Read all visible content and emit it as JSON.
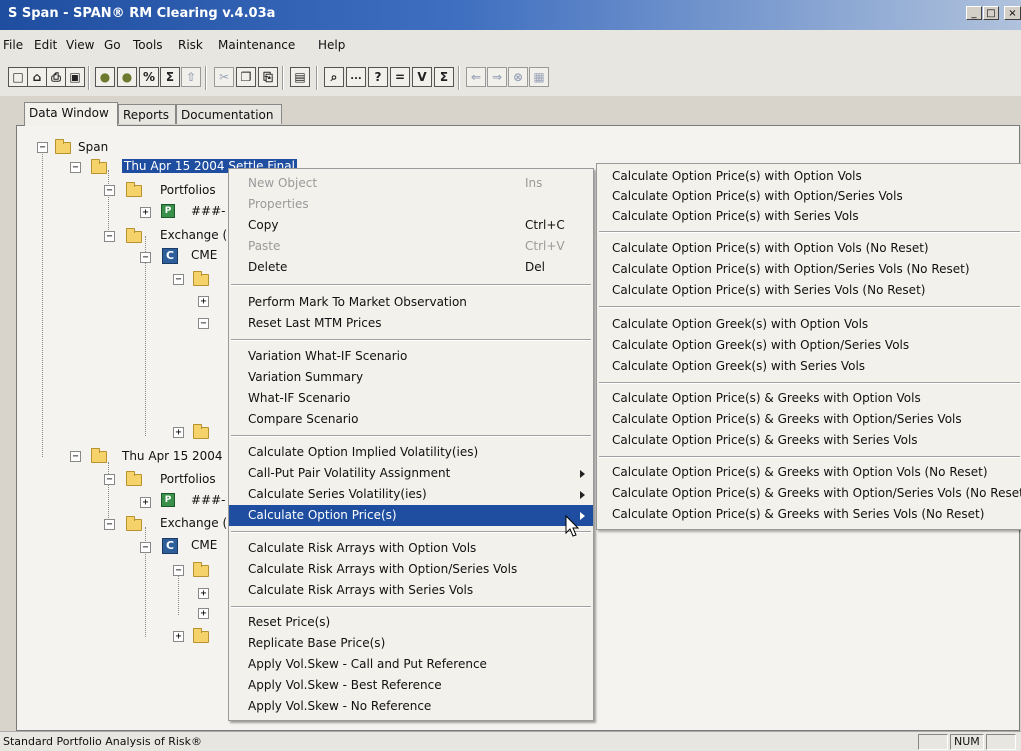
{
  "window": {
    "title": "S Span - SPAN® RM Clearing v.4.03a",
    "minimize": "_",
    "restore": "□",
    "close": "×"
  },
  "menubar": [
    "File",
    "Edit",
    "View",
    "Go",
    "Tools",
    "Risk",
    "Maintenance",
    "Help"
  ],
  "toolbar": {
    "buttons": [
      {
        "icon": "new-icon",
        "glyph": "□"
      },
      {
        "icon": "open-icon",
        "glyph": "⌂"
      },
      {
        "icon": "print-icon",
        "glyph": "⎙"
      },
      {
        "icon": "save-icon",
        "glyph": "▣"
      },
      {
        "icon": "risk-icon-1",
        "glyph": "●"
      },
      {
        "icon": "risk-icon-2",
        "glyph": "●"
      },
      {
        "icon": "percent-icon",
        "glyph": "%"
      },
      {
        "icon": "sigma-icon",
        "glyph": "Σ"
      },
      {
        "icon": "upload-icon",
        "glyph": "⇧"
      },
      {
        "icon": "cut-icon",
        "glyph": "✂"
      },
      {
        "icon": "copy-icon",
        "glyph": "❐"
      },
      {
        "icon": "paste-icon",
        "glyph": "⎘"
      },
      {
        "icon": "properties-icon",
        "glyph": "▤"
      },
      {
        "icon": "find-icon",
        "glyph": "⌕"
      },
      {
        "icon": "ellipsis-icon",
        "glyph": "..."
      },
      {
        "icon": "help-icon",
        "glyph": "?"
      },
      {
        "icon": "equals-icon",
        "glyph": "="
      },
      {
        "icon": "v-icon",
        "glyph": "V"
      },
      {
        "icon": "sigma-sub-icon",
        "glyph": "Σ"
      },
      {
        "icon": "back-icon",
        "glyph": "⇐"
      },
      {
        "icon": "forward-icon",
        "glyph": "⇒"
      },
      {
        "icon": "stop-icon",
        "glyph": "⊗"
      },
      {
        "icon": "refresh-icon",
        "glyph": "▦"
      }
    ]
  },
  "tabs": [
    "Data Window",
    "Reports",
    "Documentation"
  ],
  "tree": {
    "root": "Span",
    "node1": "Thu Apr 15 2004 Settle Final",
    "portfolios": "Portfolios",
    "hash": "###-",
    "exchange": "Exchange (",
    "cme": "CME",
    "node2": "Thu Apr 15 2004",
    "expand_plus": "+",
    "expand_minus": "−",
    "c_icon": "C",
    "p_icon": "P"
  },
  "context_menu": {
    "items": [
      {
        "label": "New Object",
        "shortcut": "Ins",
        "disabled": true
      },
      {
        "label": "Properties",
        "shortcut": "",
        "disabled": true
      },
      {
        "label": "Copy",
        "shortcut": "Ctrl+C",
        "disabled": false
      },
      {
        "label": "Paste",
        "shortcut": "Ctrl+V",
        "disabled": true
      },
      {
        "label": "Delete",
        "shortcut": "Del",
        "disabled": false
      },
      {
        "label": "Perform Mark To Market Observation"
      },
      {
        "label": "Reset Last MTM Prices"
      },
      {
        "label": "Variation What-IF Scenario"
      },
      {
        "label": "Variation Summary"
      },
      {
        "label": "What-IF Scenario"
      },
      {
        "label": "Compare Scenario"
      },
      {
        "label": "Calculate Option Implied Volatility(ies)"
      },
      {
        "label": "Call-Put Pair Volatility Assignment"
      },
      {
        "label": "Calculate Series Volatility(ies)"
      },
      {
        "label": "Calculate Option Price(s)"
      },
      {
        "label": "Calculate Risk Arrays with Option Vols"
      },
      {
        "label": "Calculate Risk Arrays with Option/Series Vols"
      },
      {
        "label": "Calculate Risk Arrays with Series Vols"
      },
      {
        "label": "Reset Price(s)"
      },
      {
        "label": "Replicate Base Price(s)"
      },
      {
        "label": "Apply Vol.Skew - Call and Put Reference"
      },
      {
        "label": "Apply Vol.Skew - Best Reference"
      },
      {
        "label": "Apply Vol.Skew - No Reference"
      }
    ]
  },
  "submenu": {
    "items": [
      "Calculate Option Price(s) with Option Vols",
      "Calculate Option Price(s) with Option/Series Vols",
      "Calculate Option Price(s) with Series Vols",
      "Calculate Option Price(s) with Option Vols (No Reset)",
      "Calculate Option Price(s) with Option/Series Vols (No Reset)",
      "Calculate Option Price(s) with Series Vols (No Reset)",
      "Calculate Option Greek(s) with Option Vols",
      "Calculate Option Greek(s) with Option/Series Vols",
      "Calculate Option Greek(s) with Series Vols",
      "Calculate Option Price(s) & Greeks with Option Vols",
      "Calculate Option Price(s) & Greeks with Option/Series Vols",
      "Calculate Option Price(s) & Greeks with Series Vols",
      "Calculate Option Price(s) & Greeks with Option Vols (No Reset)",
      "Calculate Option Price(s) & Greeks with Option/Series Vols (No Reset",
      "Calculate Option Price(s) & Greeks with Series Vols (No Reset)"
    ]
  },
  "statusbar": {
    "text": "Standard Portfolio Analysis of Risk®",
    "num": "NUM"
  },
  "colors": {
    "selection": "#1f4ea0",
    "titlebar": "#1f4ea0",
    "folder": "#f5d36a"
  }
}
